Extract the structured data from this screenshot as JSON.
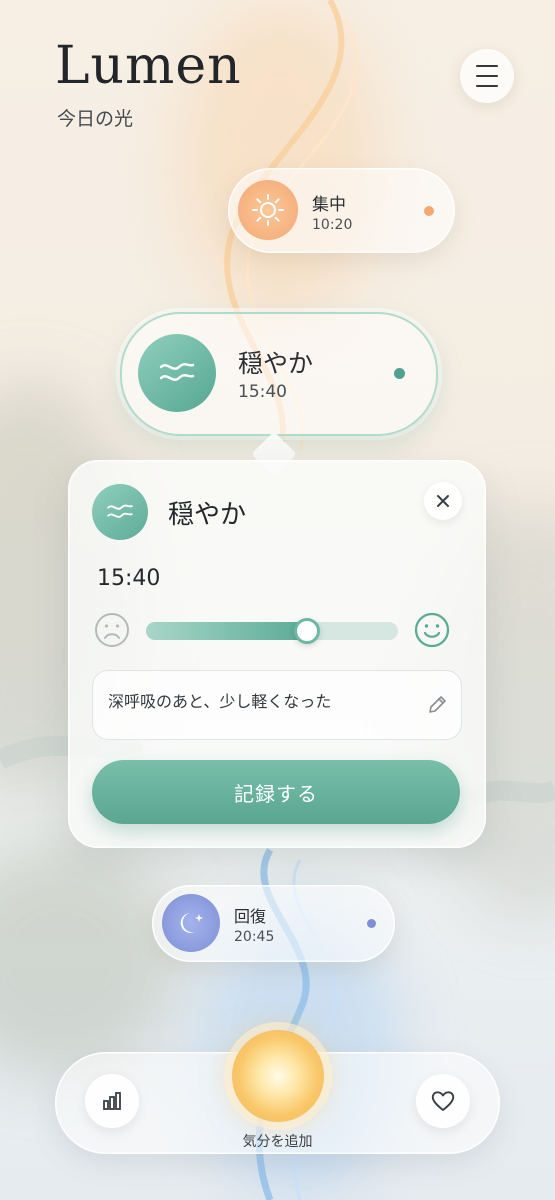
{
  "header": {
    "title": "Lumen",
    "subtitle": "今日の光"
  },
  "moods": [
    {
      "label": "集中",
      "time": "10:20",
      "icon": "sun-icon",
      "color": "#f3a872"
    },
    {
      "label": "穏やか",
      "time": "15:40",
      "icon": "waves-icon",
      "color": "#5aab96"
    },
    {
      "label": "回復",
      "time": "20:45",
      "icon": "moon-icon",
      "color": "#7d8fd6"
    }
  ],
  "detail": {
    "title": "穏やか",
    "time": "15:40",
    "mood_level": 0.64,
    "note": "深呼吸のあと、少し軽くなった",
    "record_label": "記録する"
  },
  "bottom_nav": {
    "add_label": "気分を追加"
  },
  "colors": {
    "accent": "#5aab96",
    "sun": "#f3a872",
    "moon": "#7d8fd6"
  }
}
